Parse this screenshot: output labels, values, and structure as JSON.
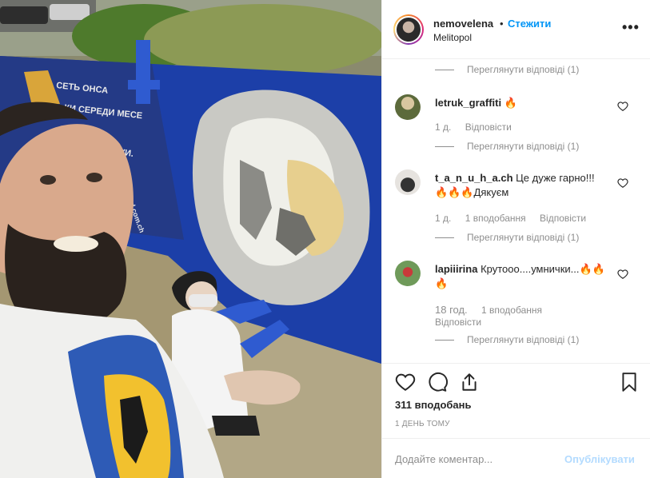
{
  "post": {
    "username": "nemovelena",
    "dot": "•",
    "follow_label": "Стежити",
    "location": "Melitopol",
    "more_icon": "more-horizontal-icon",
    "more_label": "•••"
  },
  "photo": {
    "mural_lines": [
      "СЕТЬ ОНСА",
      "КИ СЕРЕДИ МЕСЕ",
      "КА АРГУИ.",
      "ed.com.ch"
    ]
  },
  "comments": [
    {
      "replies_label": "Переглянути відповіді (1)"
    },
    {
      "user": "letruk_graffiti",
      "text": "🔥",
      "time": "1 д.",
      "likes": "",
      "reply_label": "Відповісти",
      "replies_label": "Переглянути відповіді (1)"
    },
    {
      "user": "t_a_n_u_h_a.ch",
      "text": "Це дуже гарно!!! 🔥🔥🔥Дякуєм",
      "time": "1 д.",
      "likes": "1 вподобання",
      "reply_label": "Відповісти",
      "replies_label": "Переглянути відповіді (1)"
    },
    {
      "user": "lapiiirina",
      "text": "Крутоoo....умнички...🔥🔥🔥",
      "time": "18 год.",
      "likes": "1 вподобання",
      "reply_label": "Відповісти",
      "replies_label": "Переглянути відповіді (1)"
    }
  ],
  "actions": {
    "like_icon": "heart-icon",
    "comment_icon": "comment-icon",
    "share_icon": "share-icon",
    "save_icon": "bookmark-icon",
    "likes_count": "311 вподобань",
    "time_ago": "1 ДЕНЬ ТОМУ"
  },
  "add_comment": {
    "placeholder": "Додайте коментар...",
    "publish_label": "Опублікувати"
  },
  "colors": {
    "link_blue": "#0095f6",
    "publish_disabled": "#b3dbff",
    "mural_blue": "#1c3fa8",
    "mural_yellow": "#f2c12e"
  }
}
